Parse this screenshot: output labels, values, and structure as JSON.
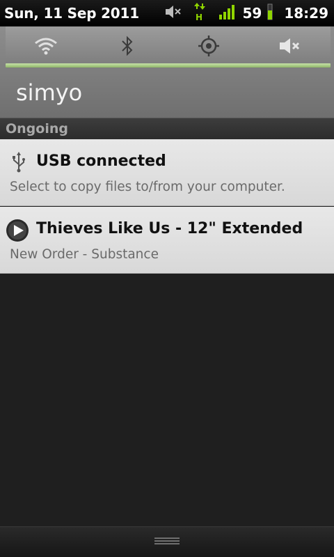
{
  "status_bar": {
    "date": "Sun, 11 Sep 2011",
    "battery": "59",
    "time": "18:29",
    "icons": [
      "mute-icon",
      "hspa-data-icon",
      "signal-strength-icon",
      "battery-icon"
    ]
  },
  "quick_settings": {
    "toggles": [
      {
        "name": "wifi",
        "icon": "wifi-icon"
      },
      {
        "name": "bluetooth",
        "icon": "bluetooth-icon"
      },
      {
        "name": "gps",
        "icon": "gps-icon"
      },
      {
        "name": "sound",
        "icon": "mute-icon"
      }
    ],
    "carrier": "simyo"
  },
  "sections": {
    "ongoing_label": "Ongoing"
  },
  "notifications": [
    {
      "icon": "usb-icon",
      "title": "USB connected",
      "text": "Select to copy files to/from your computer."
    },
    {
      "icon": "play-icon",
      "title": "Thieves Like Us - 12\" Extended",
      "text": "New Order - Substance"
    }
  ],
  "colors": {
    "signal_green": "#8fd400",
    "toggle_bar": "#a9cd86"
  }
}
